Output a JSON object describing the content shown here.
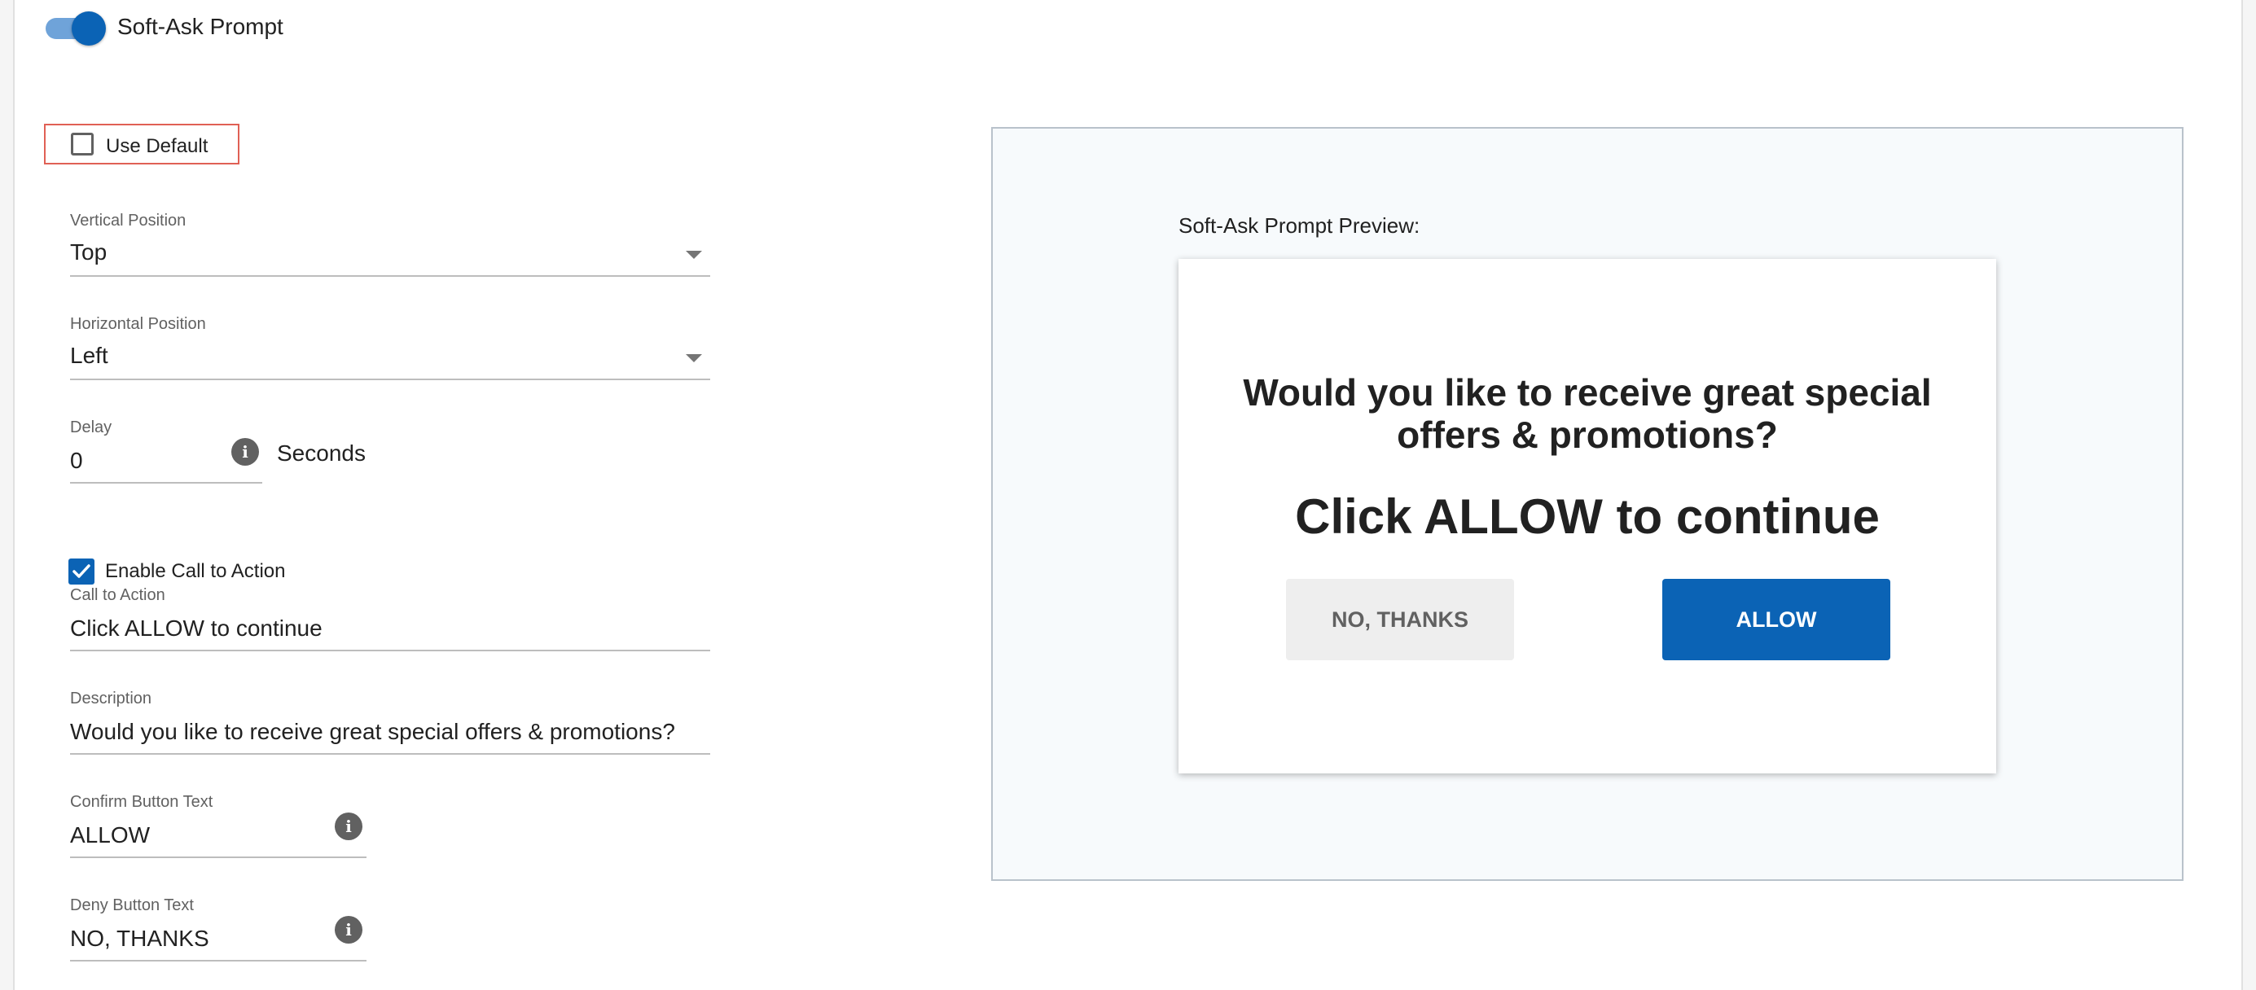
{
  "toggle": {
    "label": "Soft-Ask Prompt",
    "on": true
  },
  "use_default": {
    "label": "Use Default",
    "checked": false
  },
  "vertical_position": {
    "label": "Vertical Position",
    "value": "Top"
  },
  "horizontal_position": {
    "label": "Horizontal Position",
    "value": "Left"
  },
  "delay": {
    "label": "Delay",
    "value": "0",
    "unit": "Seconds"
  },
  "enable_cta": {
    "label": "Enable Call to Action",
    "checked": true
  },
  "call_to_action": {
    "label": "Call to Action",
    "value": "Click ALLOW to continue"
  },
  "description": {
    "label": "Description",
    "value": "Would you like to receive great special offers & promotions?"
  },
  "confirm_button": {
    "label": "Confirm Button Text",
    "value": "ALLOW"
  },
  "deny_button": {
    "label": "Deny Button Text",
    "value": "NO, THANKS"
  },
  "preview": {
    "title": "Soft-Ask Prompt Preview:",
    "description": "Would you like to receive great special offers & promotions?",
    "call_to_action": "Click ALLOW to continue",
    "deny_label": "NO, THANKS",
    "allow_label": "ALLOW"
  },
  "colors": {
    "accent": "#0b63b5",
    "toggle_track": "#6fa3d9",
    "highlight_border": "#e06055"
  },
  "icons": {
    "info": "info-icon",
    "dropdown": "chevron-down-icon",
    "check": "check-icon"
  }
}
